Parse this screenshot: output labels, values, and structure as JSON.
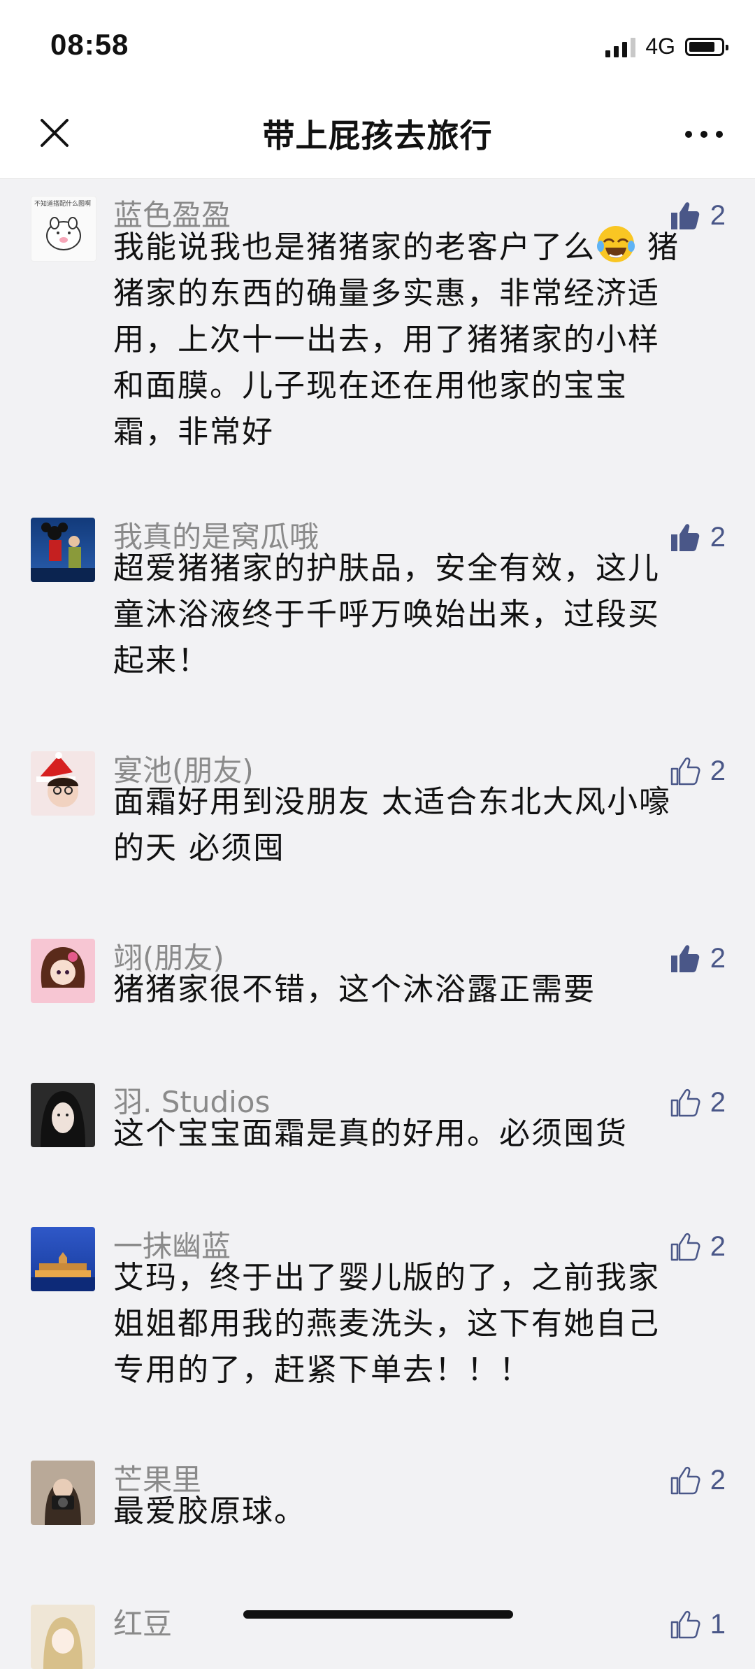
{
  "status": {
    "time": "08:58",
    "network": "4G"
  },
  "nav": {
    "title": "带上屁孩去旅行"
  },
  "comments": [
    {
      "name": "蓝色盈盈",
      "likes": "2",
      "liked": true,
      "lines": [
        "我能说我也是猪猪家的老客户了么",
        "猪家的东西的确量多实惠，非常经济适",
        "用，上次十一出去，用了猪猪家的小样",
        "和面膜。儿子现在还在用他家的宝宝",
        "霜，非常好"
      ],
      "line0_tail": "猪",
      "avatar_caption": "不知道搭配什么图啊"
    },
    {
      "name": "我真的是窝瓜哦",
      "likes": "2",
      "liked": true,
      "lines": [
        "超爱猪猪家的护肤品，安全有效，这儿",
        "童沐浴液终于千呼万唤始出来，过段买",
        "起来！"
      ]
    },
    {
      "name": "宴池(朋友)",
      "likes": "2",
      "liked": false,
      "lines": [
        "面霜好用到没朋友 太适合东北大风小嚎",
        "的天 必须囤"
      ]
    },
    {
      "name": "翊(朋友)",
      "likes": "2",
      "liked": true,
      "lines": [
        "猪猪家很不错，这个沐浴露正需要"
      ]
    },
    {
      "name": "羽. Studios",
      "likes": "2",
      "liked": false,
      "lines": [
        "这个宝宝面霜是真的好用。必须囤货"
      ]
    },
    {
      "name": "一抹幽蓝",
      "likes": "2",
      "liked": false,
      "lines": [
        "艾玛，终于出了婴儿版的了，之前我家",
        "姐姐都用我的燕麦洗头，这下有她自己",
        "专用的了，赶紧下单去！！！"
      ]
    },
    {
      "name": "芒果里",
      "likes": "2",
      "liked": false,
      "lines": [
        "最爱胶原球。"
      ]
    },
    {
      "name": "红豆",
      "likes": "1",
      "liked": false,
      "lines": []
    }
  ],
  "colors": {
    "like_filled": "#4a5788",
    "like_outline": "#4a5788",
    "name_gray": "#8a8a8a"
  }
}
